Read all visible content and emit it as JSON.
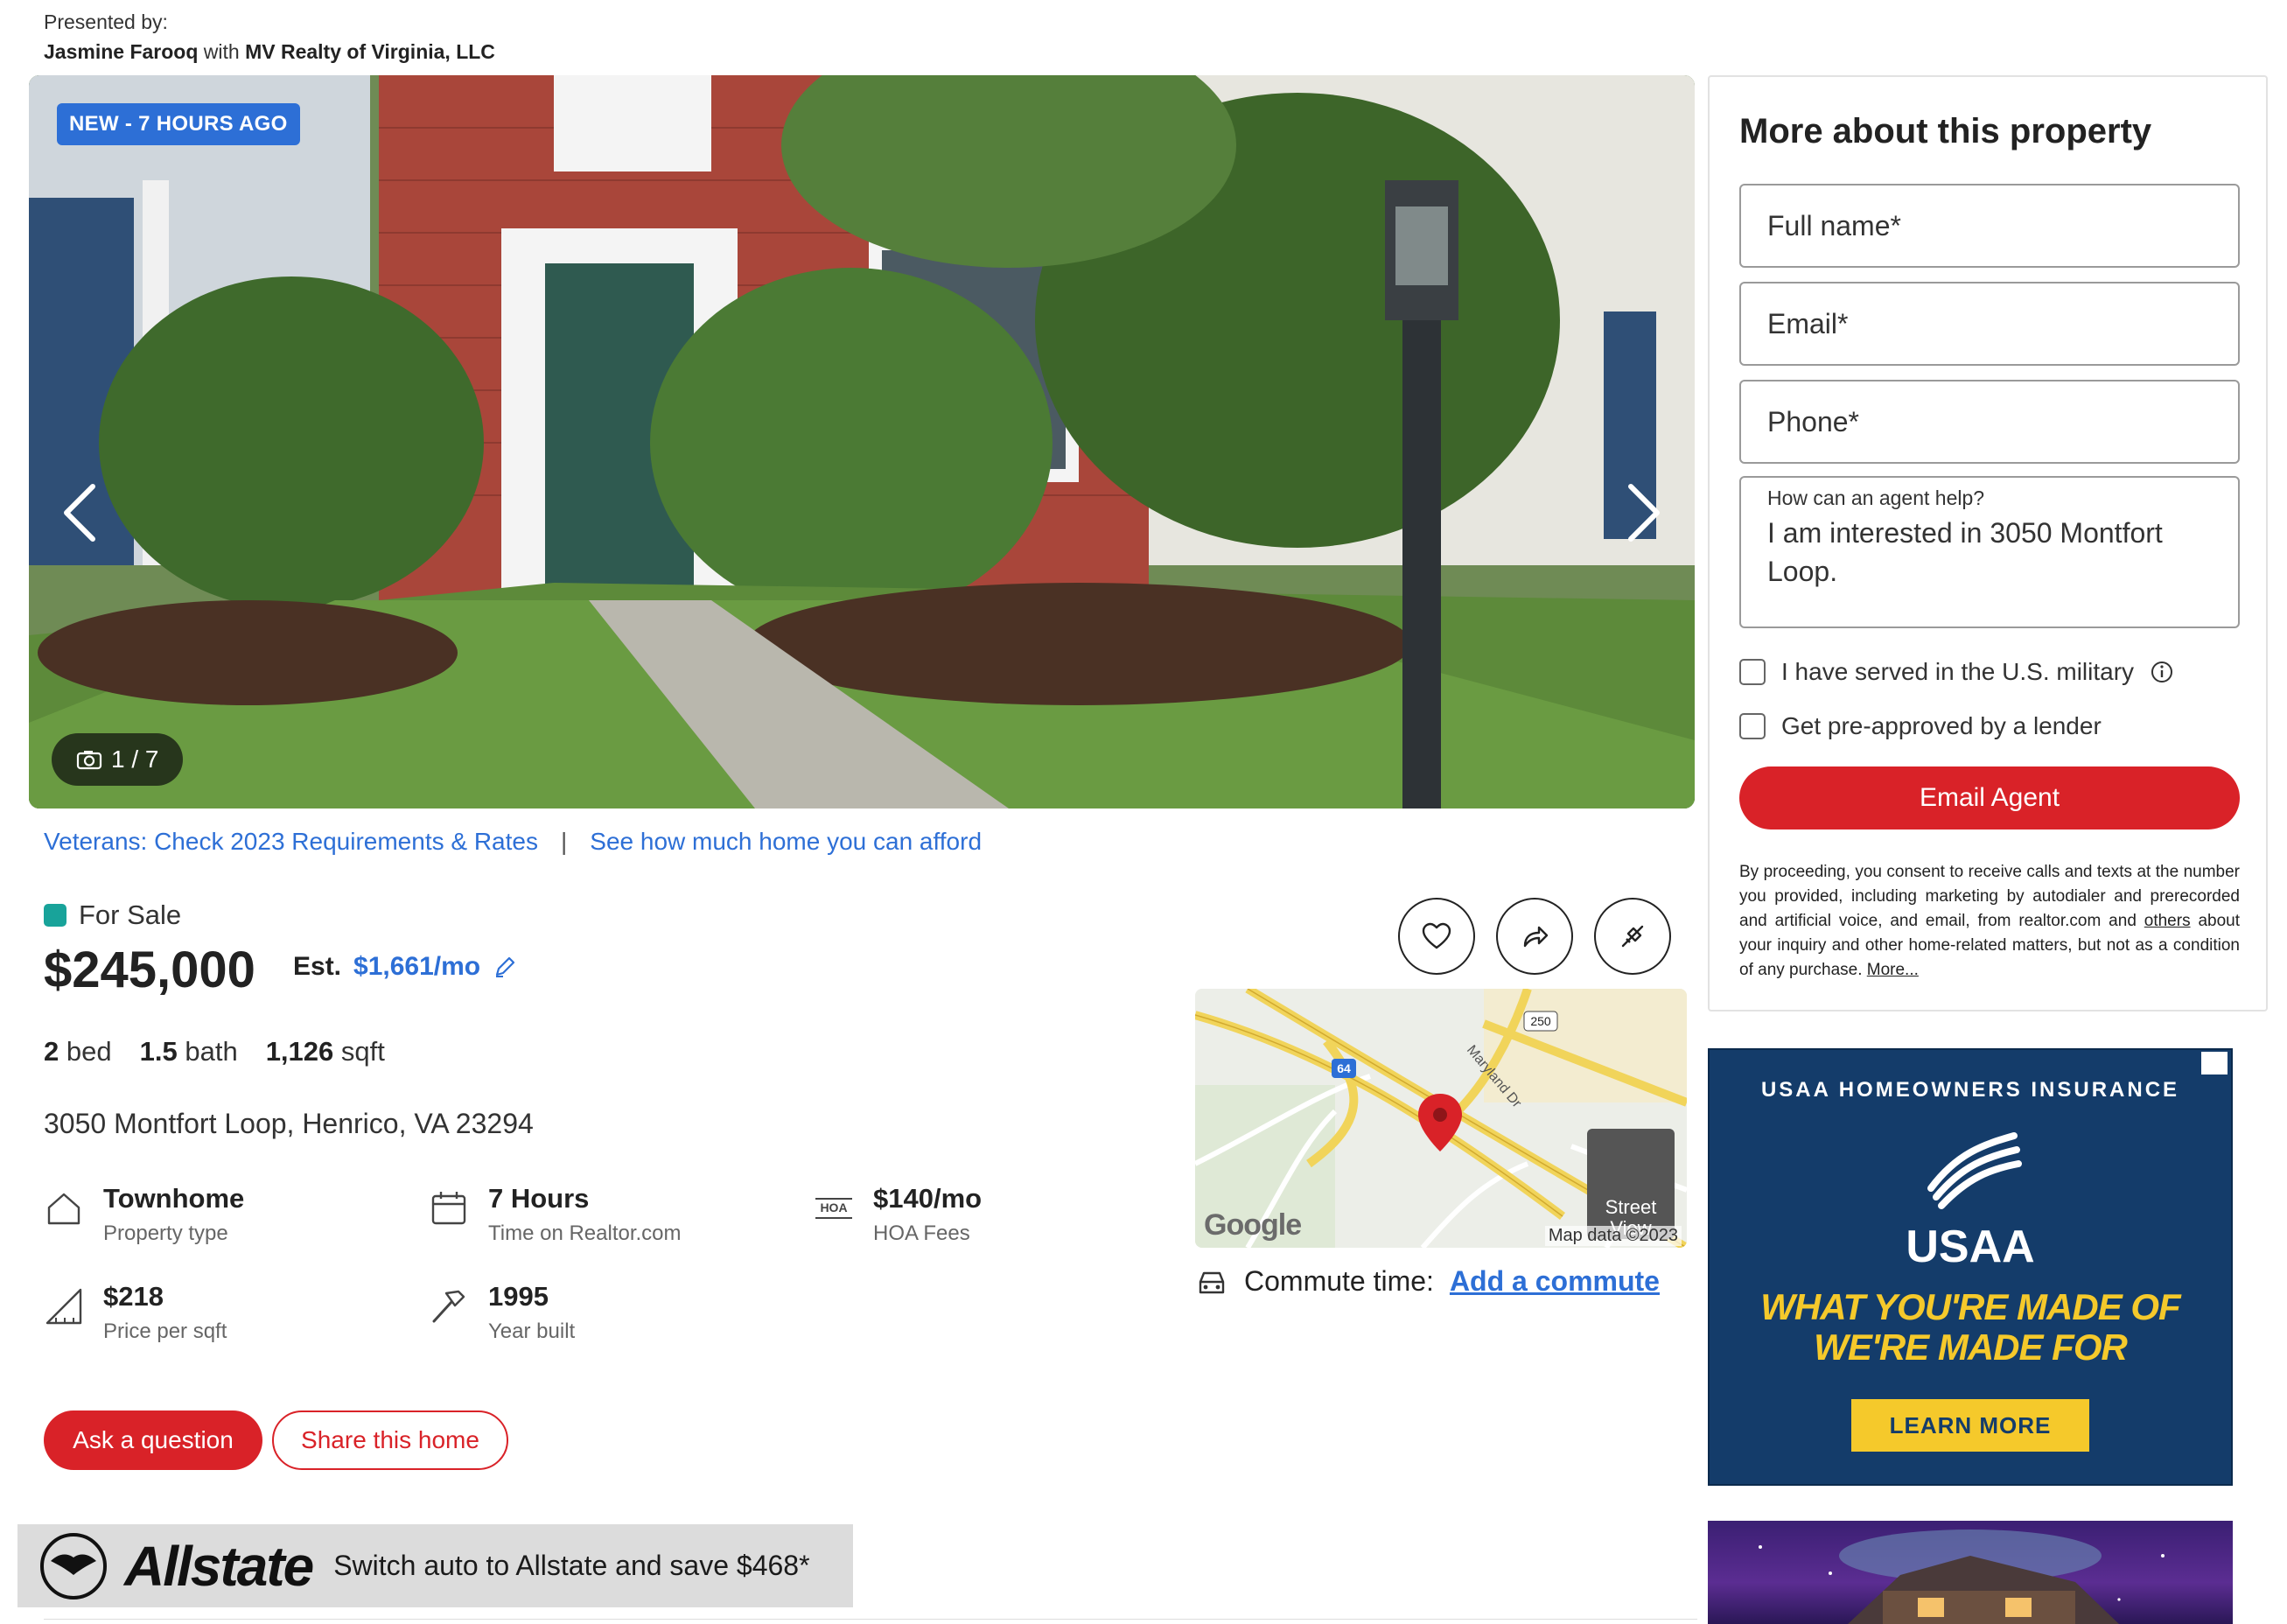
{
  "presented": {
    "label": "Presented by:",
    "agent": "Jasmine Farooq",
    "with": "with",
    "brokerage": "MV Realty of Virginia, LLC"
  },
  "gallery": {
    "badge": "NEW - 7 HOURS AGO",
    "counter": "1 / 7"
  },
  "links": {
    "veterans": "Veterans: Check 2023 Requirements & Rates",
    "separator": "|",
    "afford": "See how much home you can afford"
  },
  "listing": {
    "status": "For Sale",
    "status_color": "#18a39a",
    "price": "$245,000",
    "est_label": "Est.",
    "est_value": "$1,661/mo",
    "beds_num": "2",
    "beds_label": "bed",
    "baths_num": "1.5",
    "baths_label": "bath",
    "sqft_num": "1,126",
    "sqft_label": "sqft",
    "address": "3050 Montfort Loop, Henrico, VA 23294"
  },
  "facts": [
    {
      "value": "Townhome",
      "label": "Property type",
      "icon": "house-icon"
    },
    {
      "value": "7 Hours",
      "label": "Time on Realtor.com",
      "icon": "calendar-icon"
    },
    {
      "value": "$140/mo",
      "label": "HOA Fees",
      "icon": "hoa-icon",
      "icon_text": "HOA"
    },
    {
      "value": "$218",
      "label": "Price per sqft",
      "icon": "ruler-icon"
    },
    {
      "value": "1995",
      "label": "Year built",
      "icon": "hammer-icon"
    }
  ],
  "actions": {
    "ask": "Ask a question",
    "share": "Share this home"
  },
  "map": {
    "street_view": "Street View",
    "google": "Google",
    "map_data": "Map data ©2023",
    "road_label": "Maryland Dr",
    "shield_64": "64",
    "shield_250": "250"
  },
  "commute": {
    "label": "Commute time:",
    "link": "Add a commute"
  },
  "form": {
    "title": "More about this property",
    "full_name_placeholder": "Full name*",
    "email_placeholder": "Email*",
    "phone_placeholder": "Phone*",
    "help_label": "How can an agent help?",
    "help_text": "I am interested in 3050 Montfort Loop.",
    "military": "I have served in the U.S. military",
    "preapproved": "Get pre-approved by a lender",
    "submit": "Email Agent",
    "consent_a": "By proceeding, you consent to receive calls and texts at the number you provided, including marketing by autodialer and prerecorded and artificial voice, and email, from realtor.com and",
    "consent_others": "others",
    "consent_b": "about your inquiry and other home-related matters, but not as a condition of any purchase.",
    "consent_more": "More..."
  },
  "ads": {
    "allstate_brand": "Allstate",
    "allstate_msg": "Switch auto to Allstate and save $468*",
    "usaa_head": "USAA HOMEOWNERS INSURANCE",
    "usaa_brand": "USAA",
    "usaa_tag1": "WHAT YOU'RE MADE OF",
    "usaa_tag2": "WE'RE MADE FOR",
    "usaa_cta": "LEARN MORE"
  },
  "colors": {
    "brand_red": "#d92228",
    "link_blue": "#2d6fd6",
    "usaa_navy": "#143c6a",
    "usaa_gold": "#f5c92b"
  }
}
